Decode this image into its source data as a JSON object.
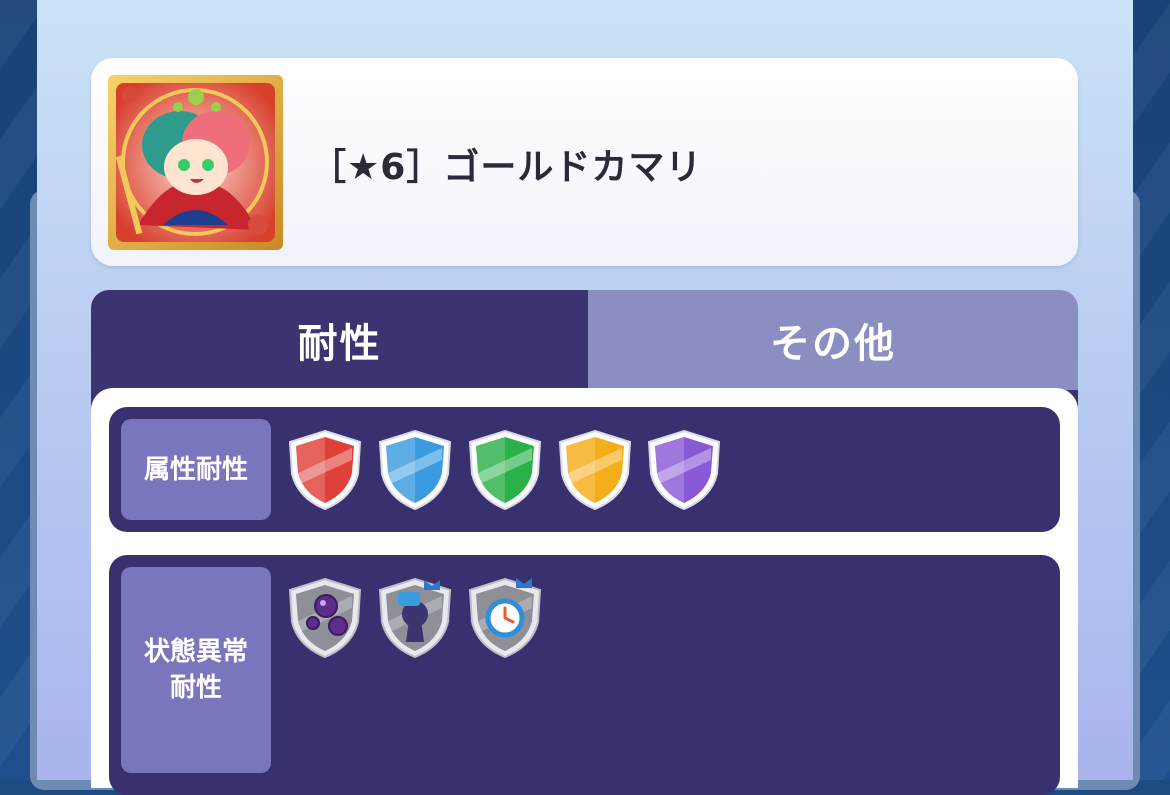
{
  "character": {
    "name": "［★6］ゴールドカマリ",
    "portrait_icon": "character-portrait"
  },
  "tabs": [
    {
      "label": "耐性",
      "active": true
    },
    {
      "label": "その他",
      "active": false
    }
  ],
  "resistance": {
    "attribute": {
      "label": "属性耐性",
      "shields": [
        {
          "icon": "red-attribute-shield-icon",
          "color": "#e0403a"
        },
        {
          "icon": "blue-attribute-shield-icon",
          "color": "#3a9be0"
        },
        {
          "icon": "green-attribute-shield-icon",
          "color": "#2bb14a"
        },
        {
          "icon": "yellow-attribute-shield-icon",
          "color": "#f5ad1a"
        },
        {
          "icon": "purple-attribute-shield-icon",
          "color": "#8a5ad6"
        }
      ]
    },
    "status": {
      "label_line1": "状態異常",
      "label_line2": "耐性",
      "shields": [
        {
          "icon": "poison-orbs-shield-icon"
        },
        {
          "icon": "lock-fist-shield-icon",
          "badge": true
        },
        {
          "icon": "clock-shield-icon",
          "badge": true
        }
      ]
    }
  }
}
